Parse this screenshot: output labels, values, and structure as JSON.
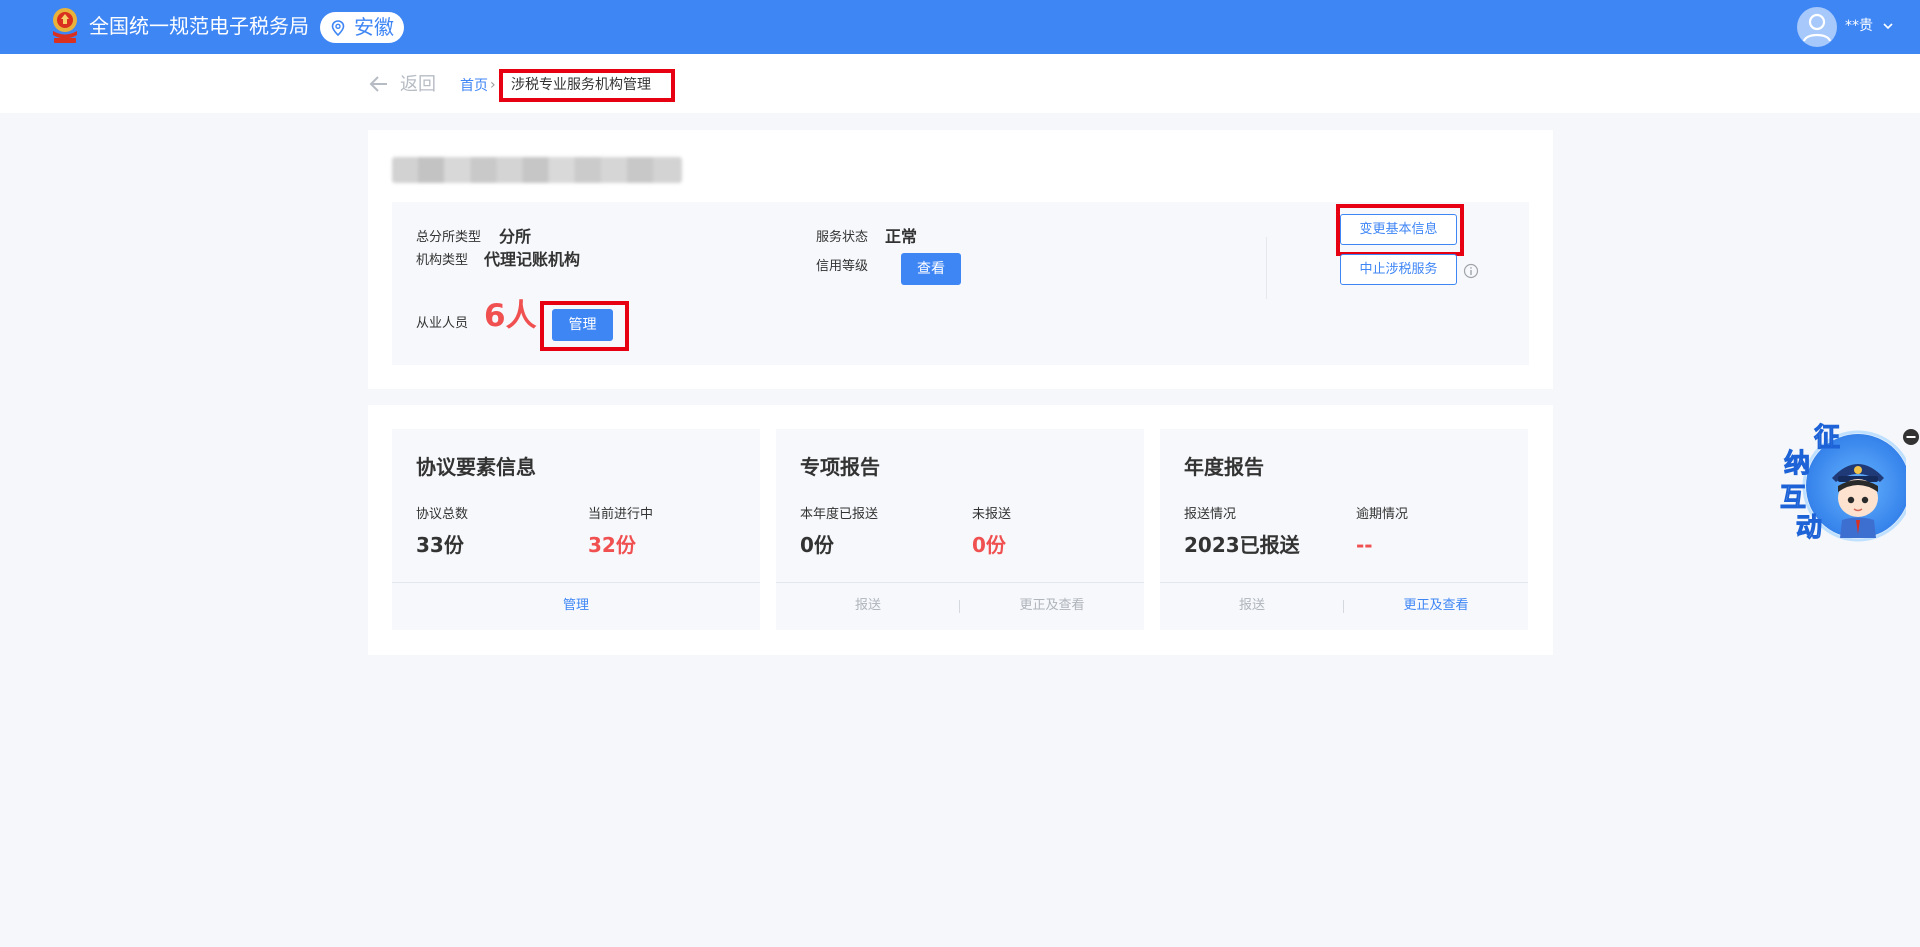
{
  "header": {
    "site_title": "全国统一规范电子税务局",
    "region": "安徽",
    "user_name": "**贵"
  },
  "breadcrumb": {
    "back_label": "返回",
    "home_label": "首页",
    "separator": "›",
    "current": "涉税专业服务机构管理"
  },
  "org": {
    "name": "■■■■■■■■■■■■■",
    "branch_type_label": "总分所类型",
    "branch_type_value": "分所",
    "org_type_label": "机构类型",
    "org_type_value": "代理记账机构",
    "service_status_label": "服务状态",
    "service_status_value": "正常",
    "credit_level_label": "信用等级",
    "credit_view_button": "查看",
    "staff_label": "从业人员",
    "staff_count": "6人",
    "staff_manage_button": "管理",
    "change_info_button": "变更基本信息",
    "stop_service_button": "中止涉税服务"
  },
  "cards": [
    {
      "title": "协议要素信息",
      "left_label": "协议总数",
      "left_value": "33份",
      "right_label": "当前进行中",
      "right_value": "32份",
      "action_label": "管理"
    },
    {
      "title": "专项报告",
      "left_label": "本年度已报送",
      "left_value": "0份",
      "right_label": "未报送",
      "right_value": "0份",
      "action_left": "报送",
      "action_right": "更正及查看"
    },
    {
      "title": "年度报告",
      "left_label": "报送情况",
      "left_value": "2023已报送",
      "right_label": "逾期情况",
      "right_value": "--",
      "action_left": "报送",
      "action_right": "更正及查看"
    }
  ],
  "mascot": {
    "text": [
      "征",
      "纳",
      "互",
      "动"
    ]
  },
  "colors": {
    "brand_blue": "#3f86f5",
    "highlight_red": "#e60012",
    "alert_red": "#f05050"
  }
}
